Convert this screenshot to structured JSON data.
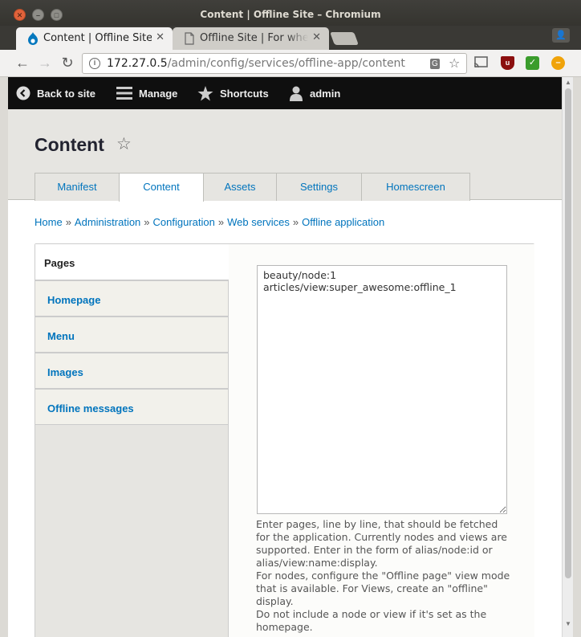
{
  "window": {
    "title": "Content | Offline Site – Chromium"
  },
  "browser_tabs": [
    {
      "label": "Content | Offline Site",
      "active": true
    },
    {
      "label": "Offline Site | For when",
      "active": false
    }
  ],
  "toolbar": {
    "url_host": "172.27.0.5",
    "url_path": "/admin/config/services/offline-app/content"
  },
  "admin_toolbar": {
    "back": "Back to site",
    "manage": "Manage",
    "shortcuts": "Shortcuts",
    "user": "admin"
  },
  "page": {
    "title": "Content",
    "tabs": [
      {
        "label": "Manifest"
      },
      {
        "label": "Content"
      },
      {
        "label": "Assets"
      },
      {
        "label": "Settings"
      },
      {
        "label": "Homescreen"
      }
    ],
    "breadcrumb": [
      "Home",
      "Administration",
      "Configuration",
      "Web services",
      "Offline application"
    ],
    "breadcrumb_separator": "»"
  },
  "vertical_tabs": {
    "items": [
      {
        "label": "Pages"
      },
      {
        "label": "Homepage"
      },
      {
        "label": "Menu"
      },
      {
        "label": "Images"
      },
      {
        "label": "Offline messages"
      }
    ],
    "pages_value": "beauty/node:1\narticles/view:super_awesome:offline_1",
    "description": [
      "Enter pages, line by line, that should be fetched for the application. Currently nodes and views are supported. Enter in the form of alias/node:id or alias/view:name:display.",
      "For nodes, configure the \"Offline page\" view mode that is available. For Views, create an \"offline\" display.",
      "Do not include a node or view if it's set as the homepage."
    ]
  },
  "colors": {
    "link": "#0074bd",
    "admin_toolbar_bg": "#0f0f0f",
    "header_bg": "#e6e5e1"
  }
}
